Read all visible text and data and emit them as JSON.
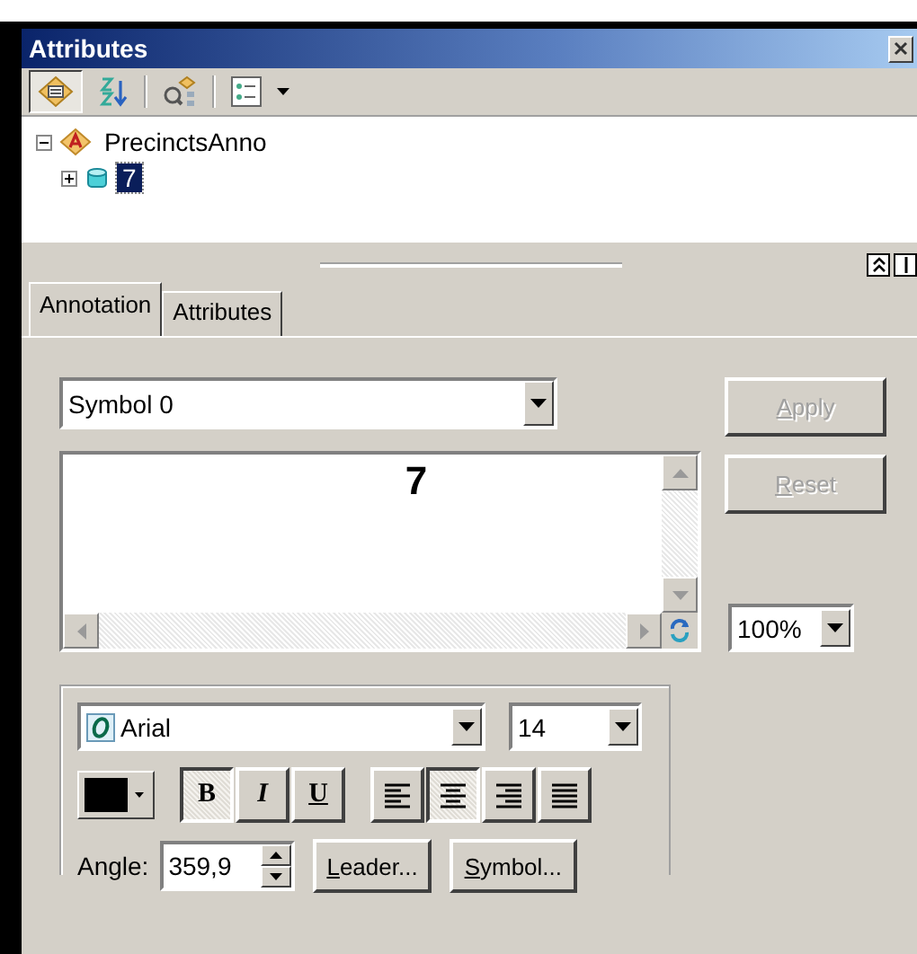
{
  "window": {
    "title": "Attributes"
  },
  "toolbar": [
    {
      "kind": "list-by-layer",
      "selected": true
    },
    {
      "kind": "sort",
      "selected": false
    },
    {
      "kind": "find",
      "selected": false
    },
    {
      "kind": "options",
      "selected": false
    }
  ],
  "tree": [
    {
      "label": "PrecinctsAnno",
      "kind": "layer",
      "expanded": true,
      "selected": false,
      "children": [
        {
          "label": "7",
          "kind": "feature",
          "expanded": false,
          "selected": false,
          "highlighted": true
        }
      ]
    }
  ],
  "tabs": [
    {
      "label": "Annotation",
      "selected": true
    },
    {
      "label": "Attributes",
      "selected": false
    }
  ],
  "symbol_dropdown": {
    "value": "Symbol 0"
  },
  "preview": {
    "text": "7"
  },
  "side_buttons": [
    {
      "label": "Apply",
      "disabled": true,
      "underline_first": true
    },
    {
      "label": "Reset",
      "disabled": true,
      "underline_first": true
    }
  ],
  "zoom_dropdown": {
    "value": "100%"
  },
  "font": {
    "name": "Arial",
    "size": "14"
  },
  "color_picker": {
    "color": "#000000"
  },
  "style_buttons": [
    {
      "label": "B",
      "kind": "bold",
      "selected": true
    },
    {
      "label": "I",
      "kind": "italic",
      "selected": false
    },
    {
      "label": "U",
      "kind": "underline",
      "selected": false
    }
  ],
  "alignment_buttons": [
    {
      "kind": "left",
      "selected": false
    },
    {
      "kind": "center",
      "selected": true
    },
    {
      "kind": "right",
      "selected": false
    },
    {
      "kind": "justify",
      "selected": false
    }
  ],
  "angle": {
    "label": "Angle:",
    "value": "359,9"
  },
  "action_buttons": [
    {
      "label": "Leader...",
      "underline_first": true
    },
    {
      "label": "Symbol...",
      "underline_first": true
    }
  ]
}
